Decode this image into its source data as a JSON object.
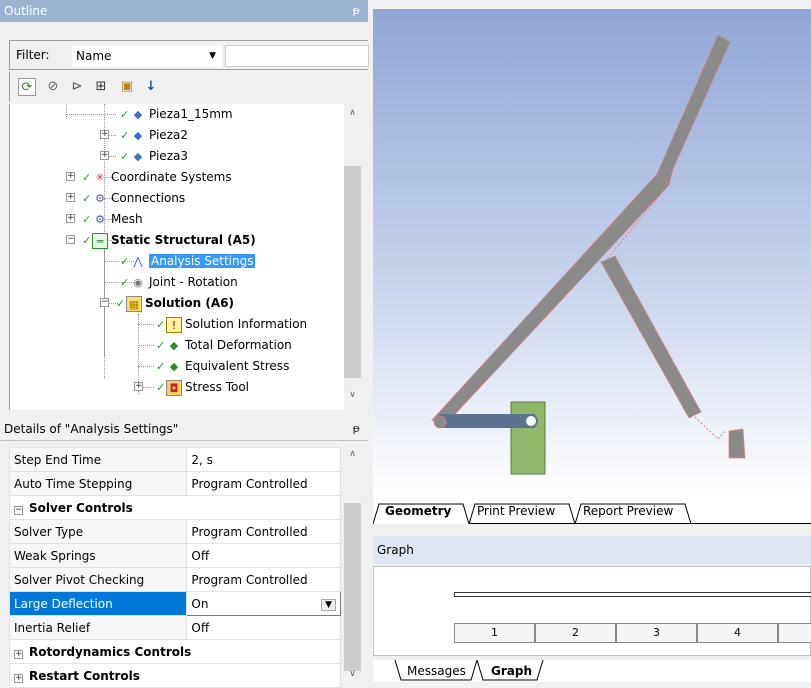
{
  "outline": {
    "title": "Outline",
    "pin": "ᵽ",
    "filter_label": "Filter:",
    "filter_value": "Name",
    "tree": [
      {
        "label": "Pieza1_15mm",
        "bold": false
      },
      {
        "label": "Pieza2",
        "bold": false
      },
      {
        "label": "Pieza3",
        "bold": false
      },
      {
        "label": "Coordinate Systems",
        "bold": false
      },
      {
        "label": "Connections",
        "bold": false
      },
      {
        "label": "Mesh",
        "bold": false
      },
      {
        "label": "Static Structural (A5)",
        "bold": true
      },
      {
        "label": "Analysis Settings",
        "bold": false
      },
      {
        "label": "Joint - Rotation",
        "bold": false
      },
      {
        "label": "Solution (A6)",
        "bold": true
      },
      {
        "label": "Solution Information",
        "bold": false
      },
      {
        "label": "Total Deformation",
        "bold": false
      },
      {
        "label": "Equivalent Stress",
        "bold": false
      },
      {
        "label": "Stress Tool",
        "bold": false
      }
    ]
  },
  "details": {
    "title": "Details of \"Analysis Settings\"",
    "rows": [
      {
        "prop": "Step End Time",
        "val": "2, s"
      },
      {
        "prop": "Auto Time Stepping",
        "val": "Program Controlled"
      },
      {
        "group": "Solver Controls",
        "sign": "−"
      },
      {
        "prop": "Solver Type",
        "val": "Program Controlled"
      },
      {
        "prop": "Weak Springs",
        "val": "Off"
      },
      {
        "prop": "Solver Pivot Checking",
        "val": "Program Controlled"
      },
      {
        "prop": "Large Deflection",
        "val": "On"
      },
      {
        "prop": "Inertia Relief",
        "val": "Off"
      },
      {
        "group": "Rotordynamics Controls",
        "sign": "+"
      },
      {
        "group": "Restart Controls",
        "sign": "+"
      }
    ]
  },
  "view_tabs": [
    "Geometry",
    "Print Preview",
    "Report Preview"
  ],
  "graph": {
    "title": "Graph",
    "cells": [
      "1",
      "2",
      "3",
      "4"
    ]
  },
  "bottom_tabs": [
    "Messages",
    "Graph"
  ],
  "colors": {
    "title_bar": "#99b4d1",
    "selection": "#3399ff",
    "shape_fill": "#808080",
    "block_fill": "#8fb86a",
    "link_fill": "#5b7390"
  }
}
